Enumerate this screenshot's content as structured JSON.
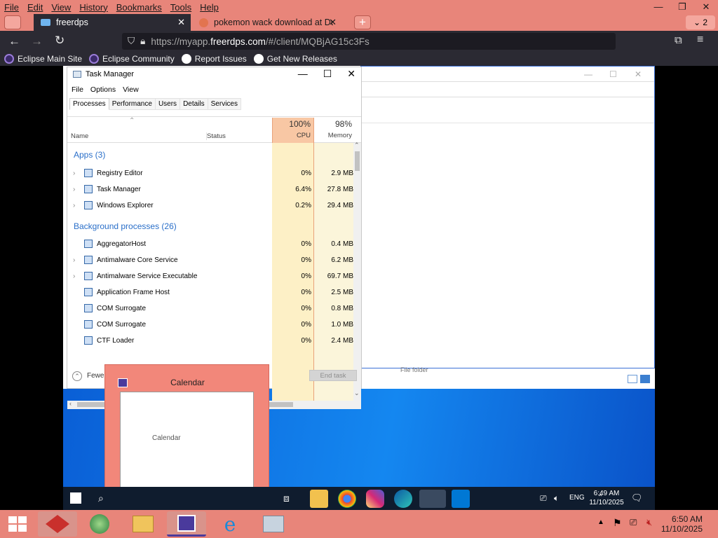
{
  "browser": {
    "menu": [
      "File",
      "Edit",
      "View",
      "History",
      "Bookmarks",
      "Tools",
      "Help"
    ],
    "tabs": [
      {
        "title": "freerdps",
        "active": true
      },
      {
        "title": "pokemon wack download at Du",
        "active": false
      }
    ],
    "tab_count": "2",
    "url_prefix": "https://myapp.",
    "url_host": "freerdps.com",
    "url_suffix": "/#/client/MQBjAG15c3Fs",
    "bookmarks": [
      "Eclipse Main Site",
      "Eclipse Community",
      "Report Issues",
      "Get New Releases"
    ]
  },
  "task_manager": {
    "title": "Task Manager",
    "menus": [
      "File",
      "Options",
      "View"
    ],
    "tabs": [
      "Processes",
      "Performance",
      "Users",
      "Details",
      "Services"
    ],
    "columns": {
      "name": "Name",
      "status": "Status",
      "cpu_pct": "100%",
      "cpu": "CPU",
      "mem_pct": "98%",
      "mem": "Memory"
    },
    "apps_header": "Apps (3)",
    "apps": [
      {
        "name": "Registry Editor",
        "cpu": "0%",
        "mem": "2.9 MB"
      },
      {
        "name": "Task Manager",
        "cpu": "6.4%",
        "mem": "27.8 MB"
      },
      {
        "name": "Windows Explorer",
        "cpu": "0.2%",
        "mem": "29.4 MB"
      }
    ],
    "bg_header": "Background processes (26)",
    "bg": [
      {
        "name": "AggregatorHost",
        "cpu": "0%",
        "mem": "0.4 MB"
      },
      {
        "name": "Antimalware Core Service",
        "cpu": "0%",
        "mem": "6.2 MB"
      },
      {
        "name": "Antimalware Service Executable",
        "cpu": "0%",
        "mem": "69.7 MB"
      },
      {
        "name": "Application Frame Host",
        "cpu": "0%",
        "mem": "2.5 MB"
      },
      {
        "name": "COM Surrogate",
        "cpu": "0%",
        "mem": "0.8 MB"
      },
      {
        "name": "COM Surrogate",
        "cpu": "0%",
        "mem": "1.0 MB"
      },
      {
        "name": "CTF Loader",
        "cpu": "0%",
        "mem": "2.4 MB"
      }
    ],
    "fewer": "Fewer",
    "end_task": "End task"
  },
  "bg_window": {
    "file_folder": "File folder"
  },
  "calendar_preview": {
    "header": "Calendar",
    "thumb_title": "Calendar"
  },
  "remote_taskbar": {
    "time": "6:49 AM",
    "date": "11/10/2025",
    "lang": "ENG"
  },
  "host_taskbar": {
    "time": "6:50 AM",
    "date": "11/10/2025"
  }
}
